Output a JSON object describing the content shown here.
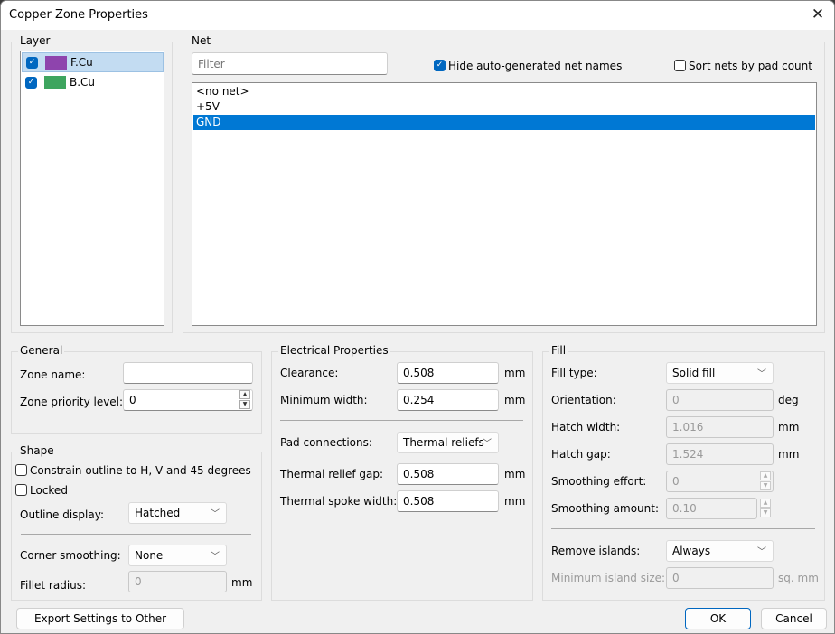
{
  "window": {
    "title": "Copper Zone Properties",
    "close_icon": "close-icon"
  },
  "layer": {
    "group_label": "Layer",
    "items": [
      {
        "name": "F.Cu",
        "color": "#8e44ad",
        "checked": true,
        "selected": true
      },
      {
        "name": "B.Cu",
        "color": "#3ea55f",
        "checked": true,
        "selected": false
      }
    ]
  },
  "net": {
    "group_label": "Net",
    "filter_placeholder": "Filter",
    "filter_value": "",
    "hide_auto_label": "Hide auto-generated net names",
    "hide_auto_checked": true,
    "sort_label": "Sort nets by pad count",
    "sort_checked": false,
    "items": [
      {
        "name": "<no net>",
        "selected": false
      },
      {
        "name": "+5V",
        "selected": false
      },
      {
        "name": "GND",
        "selected": true
      }
    ]
  },
  "general": {
    "group_label": "General",
    "zone_name_label": "Zone name:",
    "zone_name_value": "",
    "priority_label": "Zone priority level:",
    "priority_value": "0"
  },
  "shape": {
    "group_label": "Shape",
    "constrain_label": "Constrain outline to H, V and 45 degrees",
    "constrain_checked": false,
    "locked_label": "Locked",
    "locked_checked": false,
    "outline_label": "Outline display:",
    "outline_value": "Hatched",
    "corner_label": "Corner smoothing:",
    "corner_value": "None",
    "fillet_label": "Fillet radius:",
    "fillet_value": "0",
    "fillet_unit": "mm"
  },
  "electrical": {
    "group_label": "Electrical Properties",
    "clearance_label": "Clearance:",
    "clearance_value": "0.508",
    "clearance_unit": "mm",
    "min_width_label": "Minimum width:",
    "min_width_value": "0.254",
    "min_width_unit": "mm",
    "pad_conn_label": "Pad connections:",
    "pad_conn_value": "Thermal reliefs",
    "relief_gap_label": "Thermal relief gap:",
    "relief_gap_value": "0.508",
    "relief_gap_unit": "mm",
    "spoke_width_label": "Thermal spoke width:",
    "spoke_width_value": "0.508",
    "spoke_width_unit": "mm"
  },
  "fill": {
    "group_label": "Fill",
    "fill_type_label": "Fill type:",
    "fill_type_value": "Solid fill",
    "orientation_label": "Orientation:",
    "orientation_value": "0",
    "orientation_unit": "deg",
    "hatch_width_label": "Hatch width:",
    "hatch_width_value": "1.016",
    "hatch_width_unit": "mm",
    "hatch_gap_label": "Hatch gap:",
    "hatch_gap_value": "1.524",
    "hatch_gap_unit": "mm",
    "smooth_effort_label": "Smoothing effort:",
    "smooth_effort_value": "0",
    "smooth_amount_label": "Smoothing amount:",
    "smooth_amount_value": "0.10",
    "remove_islands_label": "Remove islands:",
    "remove_islands_value": "Always",
    "min_island_label": "Minimum island size:",
    "min_island_value": "0",
    "min_island_unit": "sq. mm"
  },
  "footer": {
    "export_label": "Export Settings to Other Zones",
    "ok_label": "OK",
    "cancel_label": "Cancel"
  }
}
